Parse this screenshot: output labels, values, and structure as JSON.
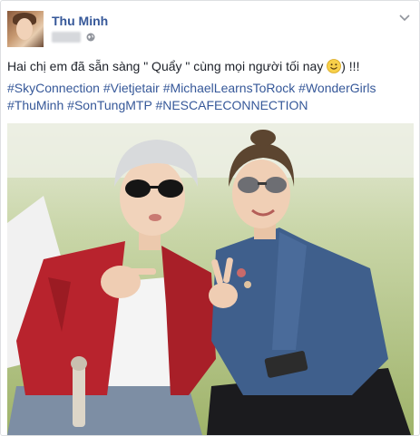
{
  "post": {
    "author": "Thu Minh",
    "text": "Hai chị em đã sẵn sàng \" Quẩy \" cùng mọi người tối nay",
    "text_suffix": ") !!!",
    "hashtags": [
      "#SkyConnection",
      "#Vietjetair",
      "#MichaelLearnsToRock",
      "#WonderGirls",
      "#ThuMinh",
      "#SonTungMTP",
      "#NESCAFECONNECTION"
    ]
  },
  "icons": {
    "audience": "globe-icon",
    "options": "chevron-down-icon",
    "emoji": "smiley-emoji-icon"
  },
  "colors": {
    "link": "#365899",
    "text": "#1d2129",
    "border": "#dddfe2"
  }
}
